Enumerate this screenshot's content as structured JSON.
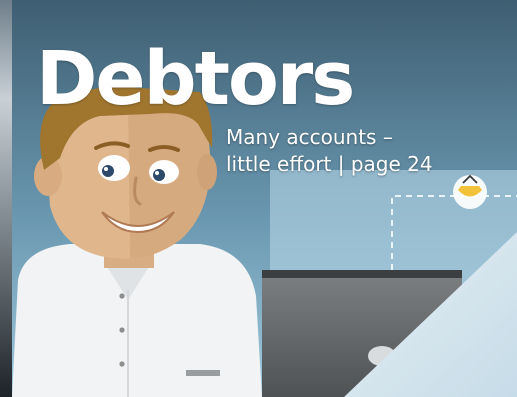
{
  "cover": {
    "headline": "Debtors",
    "subtitle_line1": "Many accounts –",
    "subtitle_line2": "little effort | page 24"
  },
  "colors": {
    "sky_top": "#3e5e72",
    "sky_bottom": "#9fc9de",
    "shirt": "#f1f3f4",
    "skin": "#e0b78d",
    "hair": "#a0762f",
    "accent_yellow": "#f2c23a"
  }
}
